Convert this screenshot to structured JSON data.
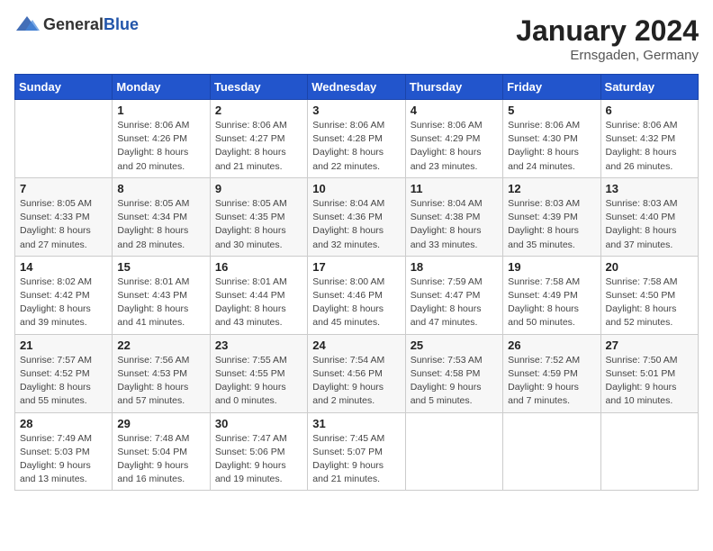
{
  "header": {
    "logo_general": "General",
    "logo_blue": "Blue",
    "title": "January 2024",
    "location": "Ernsgaden, Germany"
  },
  "weekdays": [
    "Sunday",
    "Monday",
    "Tuesday",
    "Wednesday",
    "Thursday",
    "Friday",
    "Saturday"
  ],
  "weeks": [
    [
      {
        "day": "",
        "info": ""
      },
      {
        "day": "1",
        "info": "Sunrise: 8:06 AM\nSunset: 4:26 PM\nDaylight: 8 hours\nand 20 minutes."
      },
      {
        "day": "2",
        "info": "Sunrise: 8:06 AM\nSunset: 4:27 PM\nDaylight: 8 hours\nand 21 minutes."
      },
      {
        "day": "3",
        "info": "Sunrise: 8:06 AM\nSunset: 4:28 PM\nDaylight: 8 hours\nand 22 minutes."
      },
      {
        "day": "4",
        "info": "Sunrise: 8:06 AM\nSunset: 4:29 PM\nDaylight: 8 hours\nand 23 minutes."
      },
      {
        "day": "5",
        "info": "Sunrise: 8:06 AM\nSunset: 4:30 PM\nDaylight: 8 hours\nand 24 minutes."
      },
      {
        "day": "6",
        "info": "Sunrise: 8:06 AM\nSunset: 4:32 PM\nDaylight: 8 hours\nand 26 minutes."
      }
    ],
    [
      {
        "day": "7",
        "info": "Sunrise: 8:05 AM\nSunset: 4:33 PM\nDaylight: 8 hours\nand 27 minutes."
      },
      {
        "day": "8",
        "info": "Sunrise: 8:05 AM\nSunset: 4:34 PM\nDaylight: 8 hours\nand 28 minutes."
      },
      {
        "day": "9",
        "info": "Sunrise: 8:05 AM\nSunset: 4:35 PM\nDaylight: 8 hours\nand 30 minutes."
      },
      {
        "day": "10",
        "info": "Sunrise: 8:04 AM\nSunset: 4:36 PM\nDaylight: 8 hours\nand 32 minutes."
      },
      {
        "day": "11",
        "info": "Sunrise: 8:04 AM\nSunset: 4:38 PM\nDaylight: 8 hours\nand 33 minutes."
      },
      {
        "day": "12",
        "info": "Sunrise: 8:03 AM\nSunset: 4:39 PM\nDaylight: 8 hours\nand 35 minutes."
      },
      {
        "day": "13",
        "info": "Sunrise: 8:03 AM\nSunset: 4:40 PM\nDaylight: 8 hours\nand 37 minutes."
      }
    ],
    [
      {
        "day": "14",
        "info": "Sunrise: 8:02 AM\nSunset: 4:42 PM\nDaylight: 8 hours\nand 39 minutes."
      },
      {
        "day": "15",
        "info": "Sunrise: 8:01 AM\nSunset: 4:43 PM\nDaylight: 8 hours\nand 41 minutes."
      },
      {
        "day": "16",
        "info": "Sunrise: 8:01 AM\nSunset: 4:44 PM\nDaylight: 8 hours\nand 43 minutes."
      },
      {
        "day": "17",
        "info": "Sunrise: 8:00 AM\nSunset: 4:46 PM\nDaylight: 8 hours\nand 45 minutes."
      },
      {
        "day": "18",
        "info": "Sunrise: 7:59 AM\nSunset: 4:47 PM\nDaylight: 8 hours\nand 47 minutes."
      },
      {
        "day": "19",
        "info": "Sunrise: 7:58 AM\nSunset: 4:49 PM\nDaylight: 8 hours\nand 50 minutes."
      },
      {
        "day": "20",
        "info": "Sunrise: 7:58 AM\nSunset: 4:50 PM\nDaylight: 8 hours\nand 52 minutes."
      }
    ],
    [
      {
        "day": "21",
        "info": "Sunrise: 7:57 AM\nSunset: 4:52 PM\nDaylight: 8 hours\nand 55 minutes."
      },
      {
        "day": "22",
        "info": "Sunrise: 7:56 AM\nSunset: 4:53 PM\nDaylight: 8 hours\nand 57 minutes."
      },
      {
        "day": "23",
        "info": "Sunrise: 7:55 AM\nSunset: 4:55 PM\nDaylight: 9 hours\nand 0 minutes."
      },
      {
        "day": "24",
        "info": "Sunrise: 7:54 AM\nSunset: 4:56 PM\nDaylight: 9 hours\nand 2 minutes."
      },
      {
        "day": "25",
        "info": "Sunrise: 7:53 AM\nSunset: 4:58 PM\nDaylight: 9 hours\nand 5 minutes."
      },
      {
        "day": "26",
        "info": "Sunrise: 7:52 AM\nSunset: 4:59 PM\nDaylight: 9 hours\nand 7 minutes."
      },
      {
        "day": "27",
        "info": "Sunrise: 7:50 AM\nSunset: 5:01 PM\nDaylight: 9 hours\nand 10 minutes."
      }
    ],
    [
      {
        "day": "28",
        "info": "Sunrise: 7:49 AM\nSunset: 5:03 PM\nDaylight: 9 hours\nand 13 minutes."
      },
      {
        "day": "29",
        "info": "Sunrise: 7:48 AM\nSunset: 5:04 PM\nDaylight: 9 hours\nand 16 minutes."
      },
      {
        "day": "30",
        "info": "Sunrise: 7:47 AM\nSunset: 5:06 PM\nDaylight: 9 hours\nand 19 minutes."
      },
      {
        "day": "31",
        "info": "Sunrise: 7:45 AM\nSunset: 5:07 PM\nDaylight: 9 hours\nand 21 minutes."
      },
      {
        "day": "",
        "info": ""
      },
      {
        "day": "",
        "info": ""
      },
      {
        "day": "",
        "info": ""
      }
    ]
  ]
}
